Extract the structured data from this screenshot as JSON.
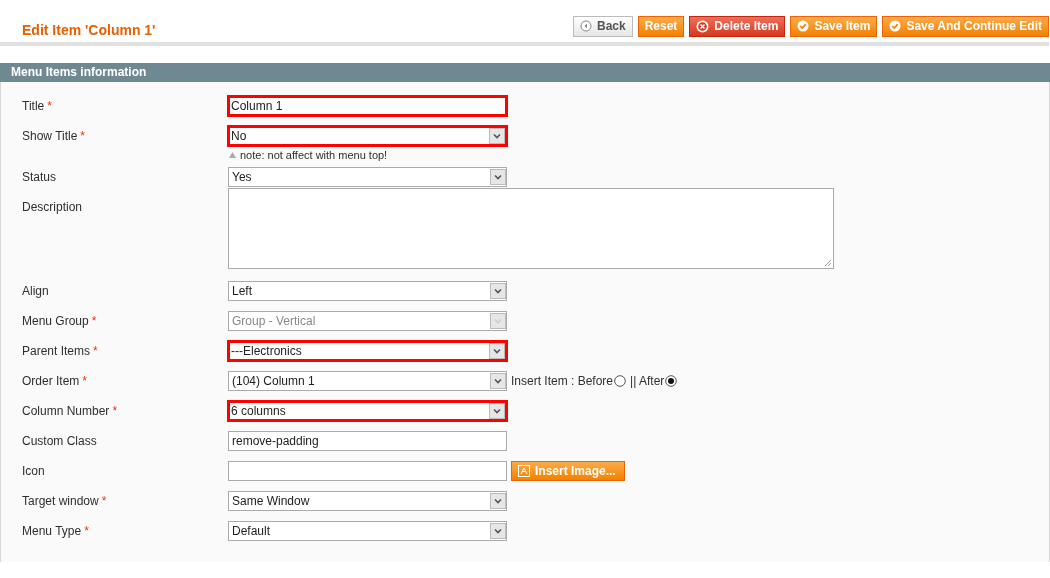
{
  "page_title": "Edit Item 'Column 1'",
  "buttons": [
    {
      "label": "Back",
      "kind": "back"
    },
    {
      "label": "Reset",
      "kind": "plain"
    },
    {
      "label": "Delete Item",
      "kind": "delete"
    },
    {
      "label": "Save Item",
      "kind": "save"
    },
    {
      "label": "Save And Continue Edit",
      "kind": "save"
    }
  ],
  "section_title": "Menu Items information",
  "fields": [
    {
      "label": "Title",
      "required_mark": "*",
      "kind": "text",
      "value": "Column 1",
      "highlighted": true
    },
    {
      "label": "Show Title",
      "required_mark": "*",
      "kind": "select",
      "value": "No",
      "highlighted": true,
      "note": "note: not affect with menu top!"
    },
    {
      "label": "Status",
      "kind": "select",
      "value": "Yes",
      "highlighted": false
    },
    {
      "label": "Description",
      "kind": "textarea",
      "highlighted": false
    },
    {
      "label": "Align",
      "kind": "select",
      "value": "Left",
      "highlighted": false
    },
    {
      "label": "Menu Group",
      "required_mark": "*",
      "kind": "select",
      "value": "Group - Vertical",
      "highlighted": false,
      "disabled": true
    },
    {
      "label": "Parent Items",
      "required_mark": "*",
      "kind": "select",
      "value": "---Electronics",
      "highlighted": true
    },
    {
      "label": "Order Item",
      "required_mark": "*",
      "kind": "select",
      "value": "(104) Column 1",
      "highlighted": false,
      "radios": [
        {
          "label": "Insert Item : Before",
          "selected": false
        },
        {
          "label": "|| After",
          "selected": true
        }
      ]
    },
    {
      "label": "Column Number",
      "required_mark": "*",
      "kind": "select",
      "value": "6 columns",
      "highlighted": true
    },
    {
      "label": "Custom Class",
      "kind": "text",
      "value": "remove-padding",
      "highlighted": false
    },
    {
      "label": "Icon",
      "kind": "text",
      "highlighted": false,
      "button": "Insert Image..."
    },
    {
      "label": "Target window",
      "required_mark": "*",
      "kind": "select",
      "value": "Same Window",
      "highlighted": false
    },
    {
      "label": "Menu Type",
      "required_mark": "*",
      "kind": "select",
      "value": "Default",
      "highlighted": false
    }
  ]
}
